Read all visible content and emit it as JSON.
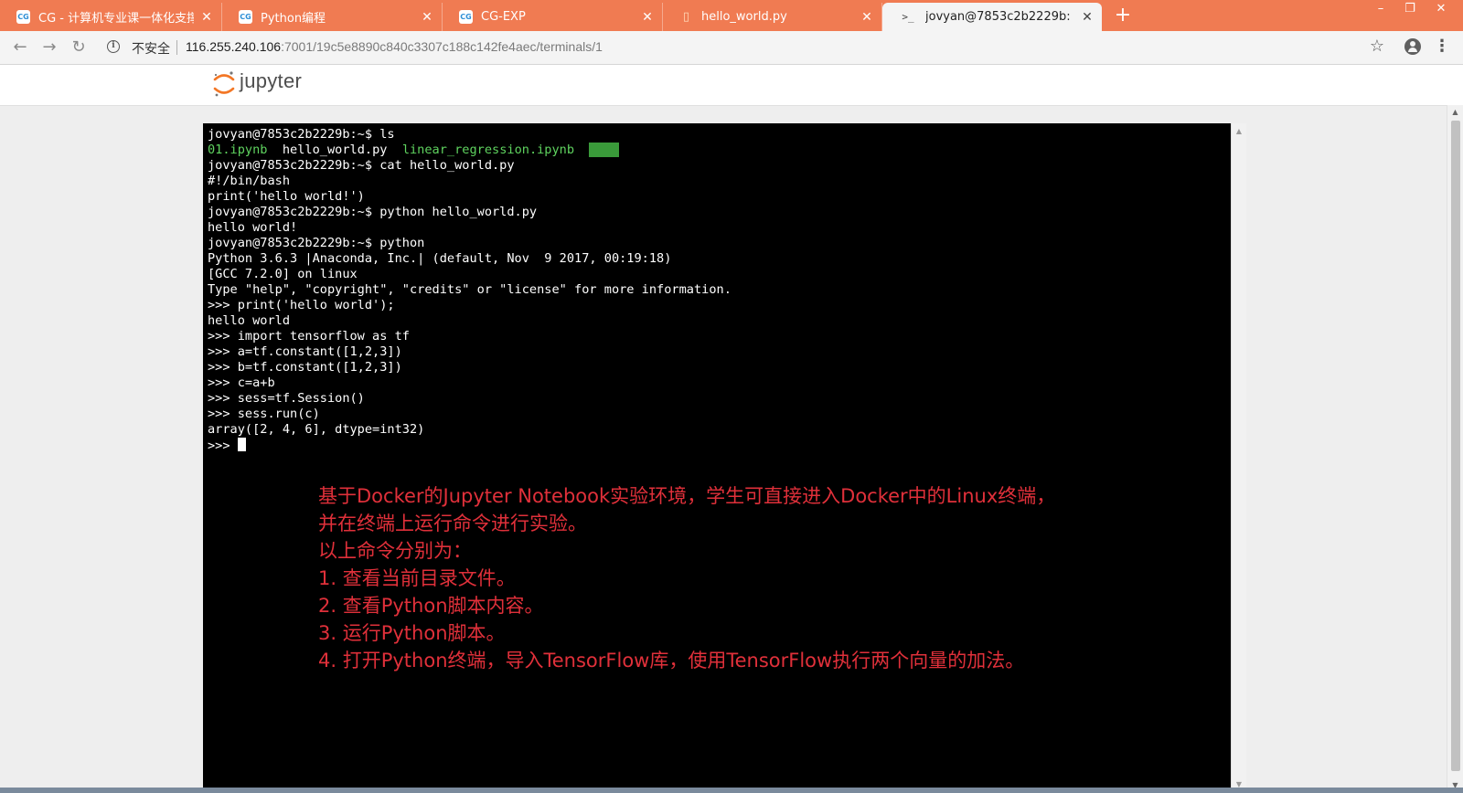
{
  "tabs": [
    {
      "title": "CG - 计算机专业课一体化支撑平",
      "icon": "cg-logo-icon",
      "icon_text": "CG",
      "close": "✕"
    },
    {
      "title": "Python编程",
      "icon": "cg-logo-icon",
      "icon_text": "CG",
      "close": "✕"
    },
    {
      "title": "CG-EXP",
      "icon": "cg-logo-icon",
      "icon_text": "CG",
      "close": "✕"
    },
    {
      "title": "hello_world.py",
      "icon": "document-icon",
      "icon_text": "▯",
      "close": "✕"
    },
    {
      "title": "jovyan@7853c2b2229b: ~",
      "icon": "terminal-icon",
      "icon_text": ">_",
      "close": "✕",
      "active": true
    }
  ],
  "new_tab_label": "+",
  "window_controls": {
    "minimize": "–",
    "restore": "❐",
    "close": "✕"
  },
  "address_bar": {
    "security_label": "不安全",
    "url_host": "116.255.240.106",
    "url_path": ":7001/19c5e8890c840c3307c188c142fe4aec/terminals/1"
  },
  "nav": {
    "back": "←",
    "forward": "→",
    "reload": "↻",
    "star": "☆",
    "menu": "⋮"
  },
  "jupyter": {
    "logo_text": "jupyter"
  },
  "terminal": {
    "lines": [
      "jovyan@7853c2b2229b:~$ ls",
      "",
      "jovyan@7853c2b2229b:~$ cat hello_world.py",
      "#!/bin/bash",
      "print('hello world!')",
      "jovyan@7853c2b2229b:~$ python hello_world.py",
      "hello world!",
      "jovyan@7853c2b2229b:~$ python",
      "Python 3.6.3 |Anaconda, Inc.| (default, Nov  9 2017, 00:19:18)",
      "[GCC 7.2.0] on linux",
      "Type \"help\", \"copyright\", \"credits\" or \"license\" for more information.",
      ">>> print('hello world');",
      "hello world",
      ">>> import tensorflow as tf",
      ">>> a=tf.constant([1,2,3])",
      ">>> b=tf.constant([1,2,3])",
      ">>> c=a+b",
      ">>> sess=tf.Session()",
      ">>> sess.run(c)",
      "array([2, 4, 6], dtype=int32)"
    ],
    "ls_output": {
      "file1": "01.ipynb",
      "sep1": "  ",
      "file2": "hello_world.py",
      "sep2": "  ",
      "file3": "linear_regression.ipynb",
      "sep3": "  ",
      "file4": "work"
    },
    "prompt": ">>> "
  },
  "annotation": [
    "基于Docker的Jupyter Notebook实验环境，学生可直接进入Docker中的Linux终端，",
    "并在终端上运行命令进行实验。",
    "以上命令分别为：",
    "1. 查看当前目录文件。",
    "2. 查看Python脚本内容。",
    "3. 运行Python脚本。",
    "4. 打开Python终端，导入TensorFlow库，使用TensorFlow执行两个向量的加法。"
  ],
  "scroll_arrows": {
    "up": "▲",
    "down": "▼"
  },
  "colors": {
    "tab_strip": "#f07b52",
    "terminal_bg": "#000000",
    "terminal_fg": "#ffffff",
    "ls_file_green": "#5fd35f",
    "annotation_red": "#e0303a",
    "jupyter_orange": "#f37726"
  }
}
